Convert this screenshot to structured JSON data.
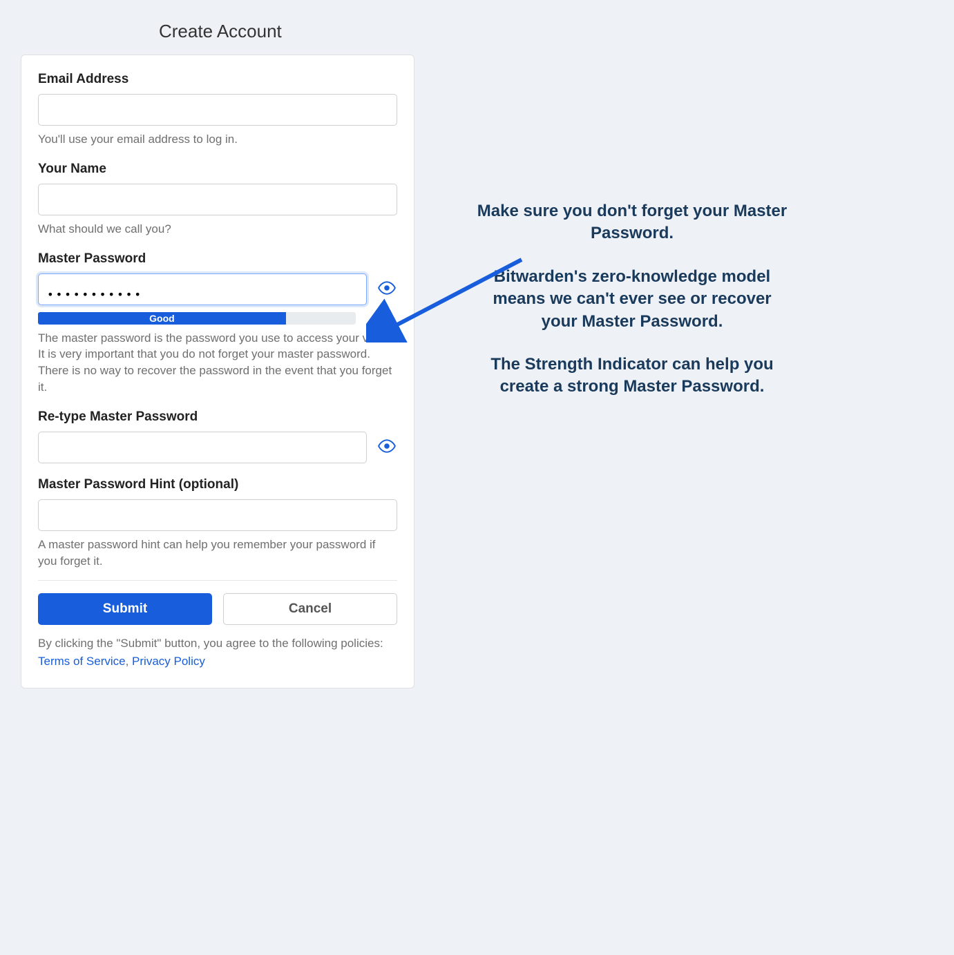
{
  "page_title": "Create Account",
  "form": {
    "email": {
      "label": "Email Address",
      "value": "",
      "help": "You'll use your email address to log in."
    },
    "name": {
      "label": "Your Name",
      "value": "",
      "help": "What should we call you?"
    },
    "master_password": {
      "label": "Master Password",
      "value": "•••••••••••",
      "strength_label": "Good",
      "strength_percent": "78%",
      "help": "The master password is the password you use to access your vault. It is very important that you do not forget your master password. There is no way to recover the password in the event that you forget it."
    },
    "retype_password": {
      "label": "Re-type Master Password",
      "value": ""
    },
    "hint": {
      "label": "Master Password Hint (optional)",
      "value": "",
      "help": "A master password hint can help you remember your password if you forget it."
    }
  },
  "buttons": {
    "submit": "Submit",
    "cancel": "Cancel"
  },
  "agree": {
    "prefix": "By clicking the \"Submit\" button, you agree to the following policies: ",
    "terms": "Terms of Service",
    "sep": ", ",
    "privacy": "Privacy Policy"
  },
  "callout": {
    "p1": "Make sure you don't forget your Master Password.",
    "p2": "Bitwarden's zero-knowledge model means we can't ever see or recover your Master Password.",
    "p3": "The Strength Indicator can help you create a strong Master Password."
  }
}
